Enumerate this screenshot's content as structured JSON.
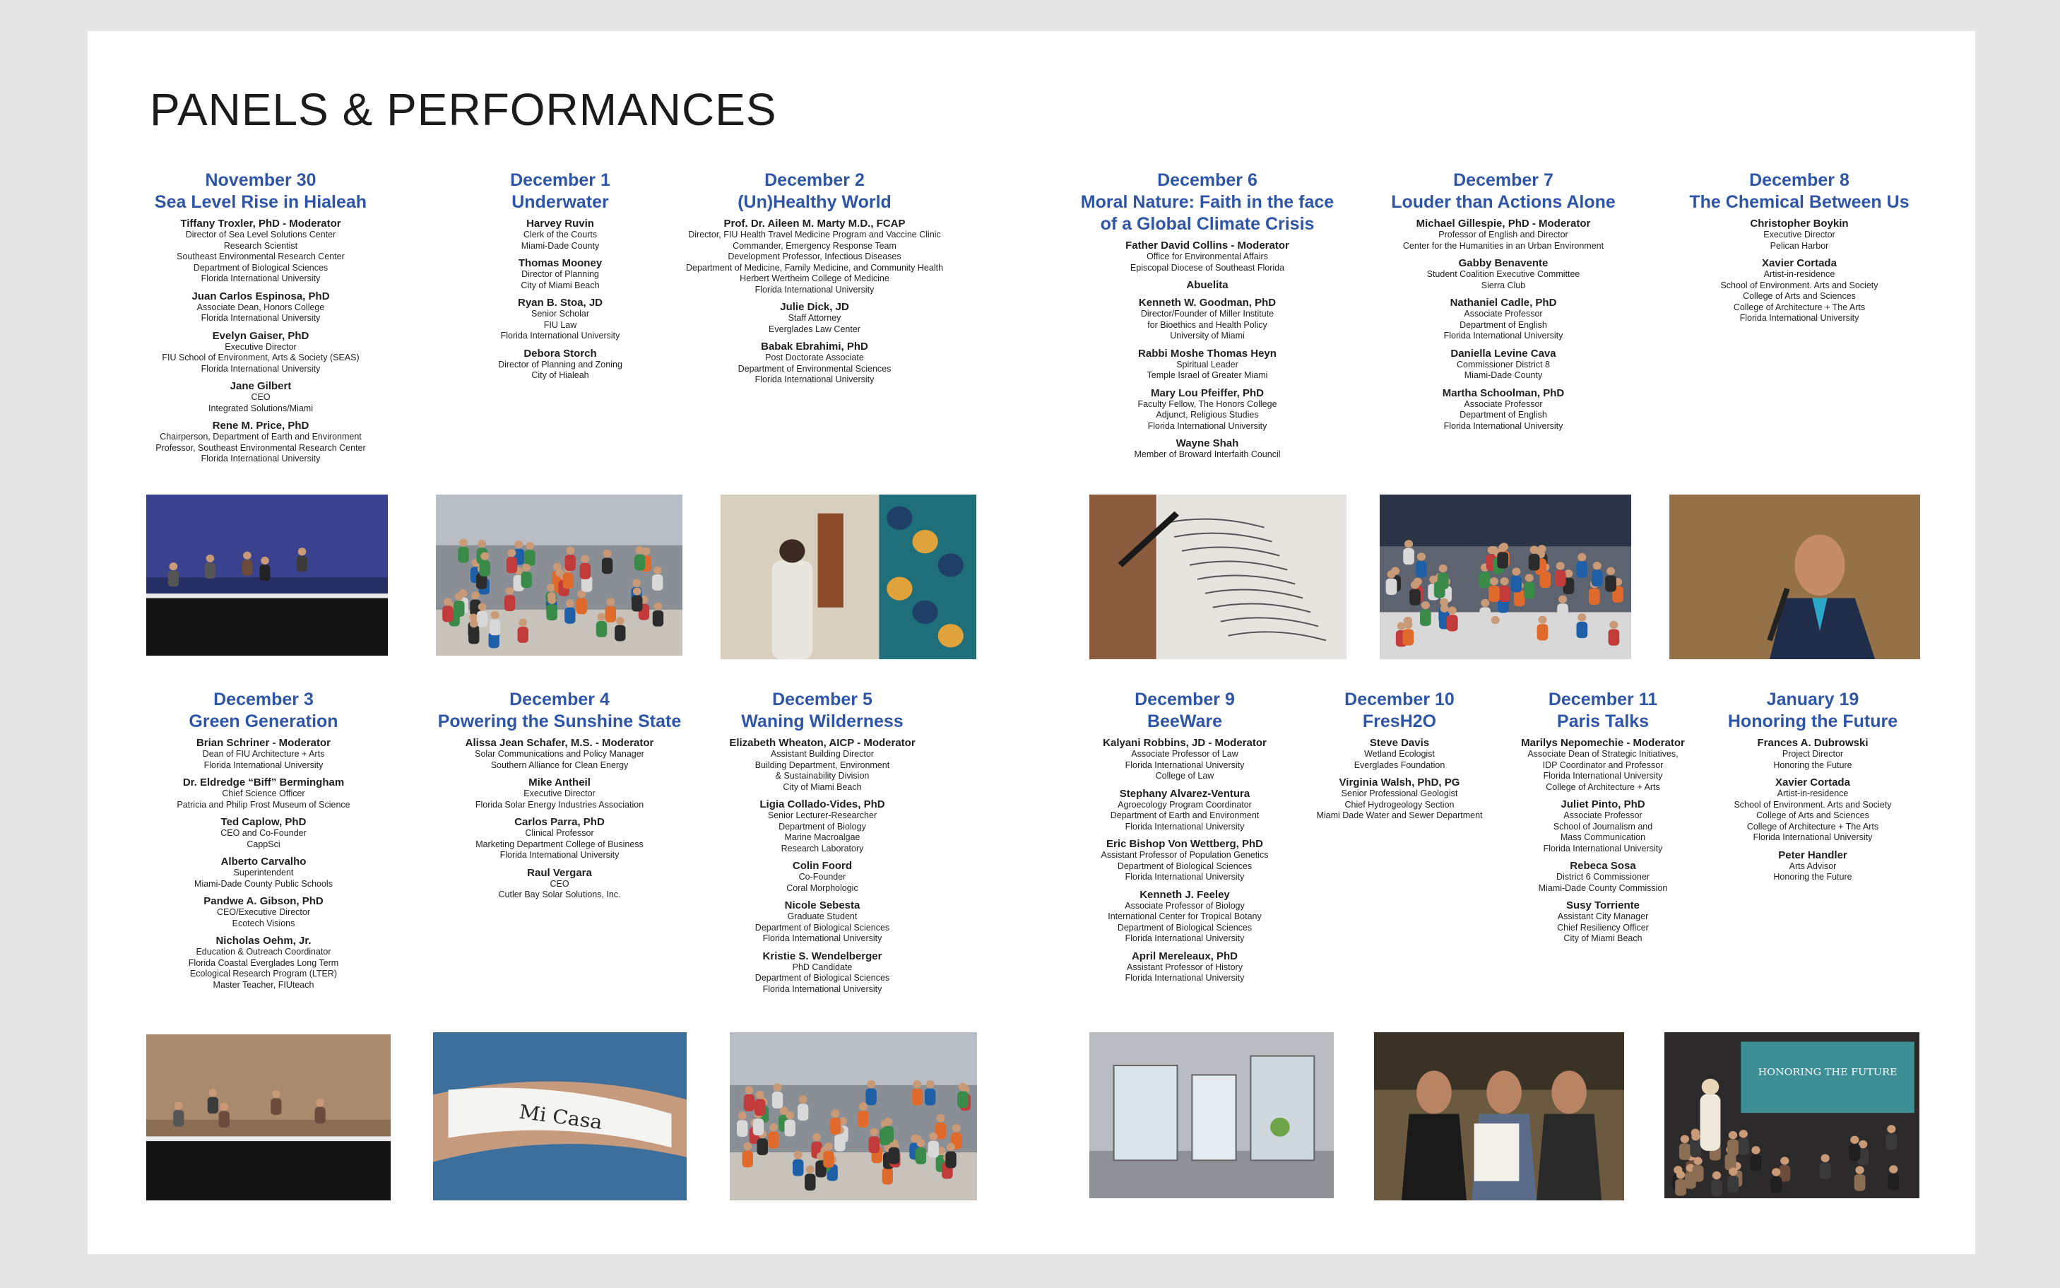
{
  "title": "PANELS & PERFORMANCES",
  "events": [
    {
      "date": "November 30",
      "title": [
        "Sea Level Rise in Hialeah"
      ],
      "speakers": [
        {
          "name": "Tiffany Troxler, PhD - Moderator",
          "lines": [
            "Director of Sea Level Solutions Center",
            "Research Scientist",
            "Southeast Environmental Research Center",
            "Department of Biological Sciences",
            "Florida International University"
          ]
        },
        {
          "name": "Juan Carlos Espinosa, PhD",
          "lines": [
            "Associate Dean, Honors College",
            "Florida International University"
          ]
        },
        {
          "name": "Evelyn Gaiser, PhD",
          "lines": [
            "Executive Director",
            "FIU School of Environment, Arts & Society (SEAS)",
            "Florida International University"
          ]
        },
        {
          "name": "Jane Gilbert",
          "lines": [
            "CEO",
            "Integrated Solutions/Miami"
          ]
        },
        {
          "name": "Rene M. Price, PhD",
          "lines": [
            "Chairperson, Department of Earth and Environment",
            "Professor, Southeast Environmental Research Center",
            "Florida International University"
          ]
        }
      ]
    },
    {
      "date": "December 1",
      "title": [
        "Underwater"
      ],
      "speakers": [
        {
          "name": "Harvey Ruvin",
          "lines": [
            "Clerk of the Courts",
            "Miami-Dade County"
          ]
        },
        {
          "name": "Thomas Mooney",
          "lines": [
            "Director of Planning",
            "City of Miami Beach"
          ]
        },
        {
          "name": "Ryan B. Stoa, JD",
          "lines": [
            "Senior Scholar",
            "FIU Law",
            "Florida International University"
          ]
        },
        {
          "name": "Debora Storch",
          "lines": [
            "Director of Planning and Zoning",
            "City of Hialeah"
          ]
        }
      ]
    },
    {
      "date": "December 2",
      "title": [
        "(Un)Healthy World"
      ],
      "speakers": [
        {
          "name": "Prof. Dr. Aileen M. Marty M.D., FCAP",
          "lines": [
            "Director, FIU Health Travel Medicine Program and Vaccine Clinic",
            "Commander, Emergency Response Team",
            "Development Professor, Infectious Diseases",
            "Department of Medicine, Family Medicine, and Community Health",
            "Herbert Wertheim College of Medicine",
            "Florida International University"
          ]
        },
        {
          "name": "Julie Dick, JD",
          "lines": [
            "Staff Attorney",
            "Everglades Law Center"
          ]
        },
        {
          "name": "Babak Ebrahimi, PhD",
          "lines": [
            "Post Doctorate Associate",
            "Department of Environmental Sciences",
            "Florida International University"
          ]
        }
      ]
    },
    {
      "date": "December 6",
      "title": [
        "Moral Nature: Faith in the face",
        "of a Global Climate Crisis"
      ],
      "speakers": [
        {
          "name": "Father David Collins - Moderator",
          "lines": [
            "Office for Environmental Affairs",
            "Episcopal Diocese of Southeast Florida"
          ]
        },
        {
          "name": "Abuelita",
          "lines": []
        },
        {
          "name": "Kenneth W. Goodman, PhD",
          "lines": [
            "Director/Founder of Miller Institute",
            "for Bioethics and Health Policy",
            "University of Miami"
          ]
        },
        {
          "name": "Rabbi Moshe Thomas Heyn",
          "lines": [
            "Spiritual Leader",
            "Temple Israel of Greater Miami"
          ]
        },
        {
          "name": "Mary Lou Pfeiffer, PhD",
          "lines": [
            "Faculty Fellow, The Honors College",
            "Adjunct, Religious Studies",
            "Florida International University"
          ]
        },
        {
          "name": "Wayne Shah",
          "lines": [
            "Member of Broward Interfaith Council"
          ]
        }
      ]
    },
    {
      "date": "December 7",
      "title": [
        "Louder than Actions Alone"
      ],
      "speakers": [
        {
          "name": "Michael Gillespie, PhD - Moderator",
          "lines": [
            "Professor of English and Director",
            "Center for the Humanities in an Urban Environment"
          ]
        },
        {
          "name": "Gabby Benavente",
          "lines": [
            "Student Coalition Executive Committee",
            "Sierra Club"
          ]
        },
        {
          "name": "Nathaniel Cadle, PhD",
          "lines": [
            "Associate Professor",
            "Department of English",
            "Florida International University"
          ]
        },
        {
          "name": "Daniella Levine Cava",
          "lines": [
            "Commissioner District 8",
            "Miami-Dade County"
          ]
        },
        {
          "name": "Martha Schoolman, PhD",
          "lines": [
            "Associate Professor",
            "Department of English",
            "Florida International University"
          ]
        }
      ]
    },
    {
      "date": "December 8",
      "title": [
        "The Chemical Between Us"
      ],
      "speakers": [
        {
          "name": "Christopher Boykin",
          "lines": [
            "Executive Director",
            "Pelican Harbor"
          ]
        },
        {
          "name": "Xavier Cortada",
          "lines": [
            "Artist-in-residence",
            "School of Environment. Arts and Society",
            "College of Arts and Sciences",
            "College of Architecture + The Arts",
            "Florida International University"
          ]
        }
      ]
    },
    {
      "date": "December 3",
      "title": [
        "Green Generation"
      ],
      "speakers": [
        {
          "name": "Brian Schriner - Moderator",
          "lines": [
            "Dean of FIU Architecture + Arts",
            "Florida International University"
          ]
        },
        {
          "name": "Dr. Eldredge “Biff” Bermingham",
          "lines": [
            "Chief Science Officer",
            "Patricia and Philip Frost Museum of Science"
          ]
        },
        {
          "name": "Ted Caplow, PhD",
          "lines": [
            "CEO and Co-Founder",
            "CappSci"
          ]
        },
        {
          "name": "Alberto Carvalho",
          "lines": [
            "Superintendent",
            "Miami-Dade County Public Schools"
          ]
        },
        {
          "name": "Pandwe A. Gibson, PhD",
          "lines": [
            "CEO/Executive Director",
            "Ecotech Visions"
          ]
        },
        {
          "name": "Nicholas Oehm, Jr.",
          "lines": [
            "Education & Outreach Coordinator",
            "Florida Coastal Everglades Long Term",
            "Ecological Research Program (LTER)",
            "Master Teacher, FIUteach"
          ]
        }
      ]
    },
    {
      "date": "December 4",
      "title": [
        "Powering the Sunshine State"
      ],
      "speakers": [
        {
          "name": "Alissa Jean Schafer, M.S. - Moderator",
          "lines": [
            "Solar Communications and Policy Manager",
            "Southern Alliance for Clean Energy"
          ]
        },
        {
          "name": "Mike Antheil",
          "lines": [
            "Executive Director",
            "Florida Solar Energy Industries Association"
          ]
        },
        {
          "name": "Carlos Parra, PhD",
          "lines": [
            "Clinical Professor",
            "Marketing Department College of Business",
            "Florida International University"
          ]
        },
        {
          "name": "Raul Vergara",
          "lines": [
            "CEO",
            "Cutler Bay Solar Solutions, Inc."
          ]
        }
      ]
    },
    {
      "date": "December 5",
      "title": [
        "Waning Wilderness"
      ],
      "speakers": [
        {
          "name": "Elizabeth Wheaton, AICP - Moderator",
          "lines": [
            "Assistant Building Director",
            "Building Department, Environment",
            "& Sustainability Division",
            "City of Miami Beach"
          ]
        },
        {
          "name": "Ligia Collado-Vides, PhD",
          "lines": [
            "Senior Lecturer-Researcher",
            "Department of Biology",
            "Marine Macroalgae",
            "Research Laboratory"
          ]
        },
        {
          "name": "Colin Foord",
          "lines": [
            "Co-Founder",
            "Coral Morphologic"
          ]
        },
        {
          "name": "Nicole Sebesta",
          "lines": [
            "Graduate Student",
            "Department of Biological Sciences",
            "Florida International University"
          ]
        },
        {
          "name": "Kristie S. Wendelberger",
          "lines": [
            "PhD Candidate",
            "Department of Biological Sciences",
            "Florida International University"
          ]
        }
      ]
    },
    {
      "date": "December 9",
      "title": [
        "BeeWare"
      ],
      "speakers": [
        {
          "name": "Kalyani Robbins, JD - Moderator",
          "lines": [
            "Associate Professor of Law",
            "Florida International University",
            "College of Law"
          ]
        },
        {
          "name": "Stephany Alvarez-Ventura",
          "lines": [
            "Agroecology Program Coordinator",
            "Department of Earth and Environment",
            "Florida International University"
          ]
        },
        {
          "name": "Eric Bishop Von Wettberg, PhD",
          "lines": [
            "Assistant Professor of Population Genetics",
            "Department of Biological Sciences",
            "Florida International University"
          ]
        },
        {
          "name": "Kenneth J. Feeley",
          "lines": [
            "Associate Professor of Biology",
            "International Center for Tropical Botany",
            "Department of Biological Sciences",
            "Florida International University"
          ]
        },
        {
          "name": "April Mereleaux, PhD",
          "lines": [
            "Assistant Professor of History",
            "Florida International University"
          ]
        }
      ]
    },
    {
      "date": "December 10",
      "title": [
        "FresH2O"
      ],
      "speakers": [
        {
          "name": "Steve Davis",
          "lines": [
            "Wetland Ecologist",
            "Everglades Foundation"
          ]
        },
        {
          "name": "Virginia Walsh, PhD, PG",
          "lines": [
            "Senior Professional Geologist",
            "Chief Hydrogeology Section",
            "Miami Dade Water and Sewer Department"
          ]
        }
      ]
    },
    {
      "date": "December 11",
      "title": [
        "Paris Talks"
      ],
      "speakers": [
        {
          "name": "Marilys Nepomechie - Moderator",
          "lines": [
            "Associate Dean of Strategic Initiatives,",
            "IDP Coordinator and Professor",
            "Florida International University",
            "College of Architecture + Arts"
          ]
        },
        {
          "name": "Juliet Pinto, PhD",
          "lines": [
            "Associate Professor",
            "School of Journalism and",
            "Mass Communication",
            "Florida International University"
          ]
        },
        {
          "name": "Rebeca Sosa",
          "lines": [
            "District 6 Commissioner",
            "Miami-Dade County Commission"
          ]
        },
        {
          "name": "Susy Torriente",
          "lines": [
            "Assistant City Manager",
            "Chief Resiliency Officer",
            "City of Miami Beach"
          ]
        }
      ]
    },
    {
      "date": "January 19",
      "title": [
        "Honoring the Future"
      ],
      "speakers": [
        {
          "name": "Frances A. Dubrowski",
          "lines": [
            "Project Director",
            "Honoring the Future"
          ]
        },
        {
          "name": "Xavier Cortada",
          "lines": [
            "Artist-in-residence",
            "School of Environment. Arts and Society",
            "College of Arts and Sciences",
            "College of Architecture + The Arts",
            "Florida International University"
          ]
        },
        {
          "name": "Peter Handler",
          "lines": [
            "Arts Advisor",
            "Honoring the Future"
          ]
        }
      ]
    }
  ],
  "photos": [
    {
      "name": "panel-stage-photo",
      "icon": "panel-discussion"
    },
    {
      "name": "group-stairs-photo",
      "icon": "crowd"
    },
    {
      "name": "gallery-art-photo",
      "icon": "artwork"
    },
    {
      "name": "handwriting-photo",
      "icon": "writing"
    },
    {
      "name": "circle-group-photo",
      "icon": "crowd"
    },
    {
      "name": "speaker-microphone-photo",
      "icon": "speaker"
    },
    {
      "name": "panel-table-photo",
      "icon": "panel-discussion"
    },
    {
      "name": "wristband-photo",
      "icon": "wristband",
      "caption": "Mi Casa"
    },
    {
      "name": "atrium-crowd-photo",
      "icon": "crowd"
    },
    {
      "name": "lab-display-photo",
      "icon": "exhibit"
    },
    {
      "name": "award-certificate-photo",
      "icon": "people"
    },
    {
      "name": "presentation-screen-photo",
      "icon": "presentation",
      "caption": "HONORING THE FUTURE"
    }
  ]
}
